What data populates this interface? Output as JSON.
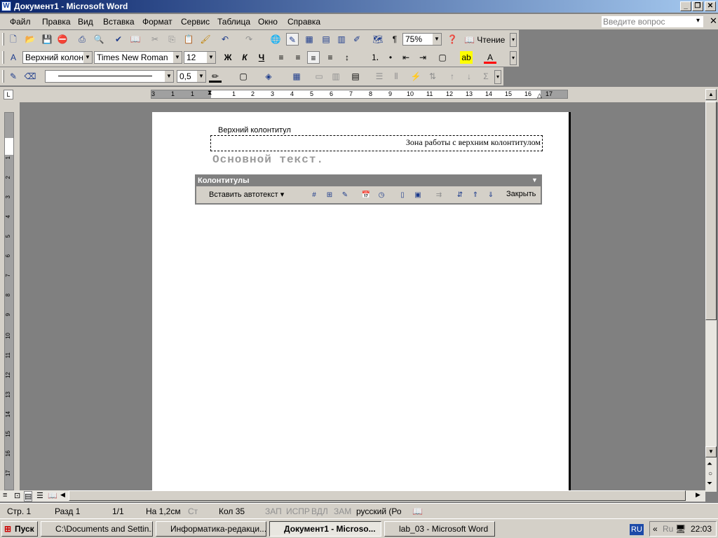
{
  "window": {
    "title": "Документ1 - Microsoft Word"
  },
  "menu": {
    "items": [
      "Файл",
      "Правка",
      "Вид",
      "Вставка",
      "Формат",
      "Сервис",
      "Таблица",
      "Окно",
      "Справка"
    ],
    "ask_placeholder": "Введите вопрос"
  },
  "toolbar_standard": {
    "zoom": "75%",
    "reading_label": "Чтение"
  },
  "toolbar_format": {
    "style": "Верхний колонт",
    "font": "Times New Roman",
    "size": "12",
    "bold": "Ж",
    "italic": "К",
    "underline": "Ч"
  },
  "toolbar_draw": {
    "line_width": "0,5"
  },
  "ruler": {
    "h_ticks": [
      "3",
      "1",
      "2",
      "1",
      "1",
      "2",
      "3",
      "4",
      "5",
      "6",
      "7",
      "8",
      "9",
      "10",
      "11",
      "12",
      "13",
      "14",
      "15",
      "16",
      "17"
    ],
    "v_ticks": [
      "1",
      "1",
      "2",
      "3",
      "4",
      "5",
      "6",
      "7",
      "8",
      "9",
      "10",
      "11",
      "12",
      "13",
      "14",
      "15",
      "16",
      "17"
    ]
  },
  "document": {
    "header_label": "Верхний колонтитул",
    "header_zone_text": "Зона работы с верхним колонтитулом",
    "body_text": "Основной текст."
  },
  "hf_toolbar": {
    "title": "Колонтитулы",
    "autotext": "Вставить автотекст",
    "close": "Закрыть"
  },
  "status": {
    "page": "Стр. 1",
    "section": "Разд 1",
    "pages": "1/1",
    "at": "На 1,2см",
    "line": "Ст",
    "col": "Кол 35",
    "rec": "ЗАП",
    "trk": "ИСПР",
    "ext": "ВДЛ",
    "ovr": "ЗАМ",
    "lang": "русский (Ро"
  },
  "taskbar": {
    "start": "Пуск",
    "tasks": [
      "C:\\Documents and Settin...",
      "Информатика-редакци...",
      "Документ1 - Microso...",
      "lab_03 - Microsoft Word"
    ],
    "lang": "RU",
    "time": "22:03",
    "tray_lang": "Ru"
  }
}
